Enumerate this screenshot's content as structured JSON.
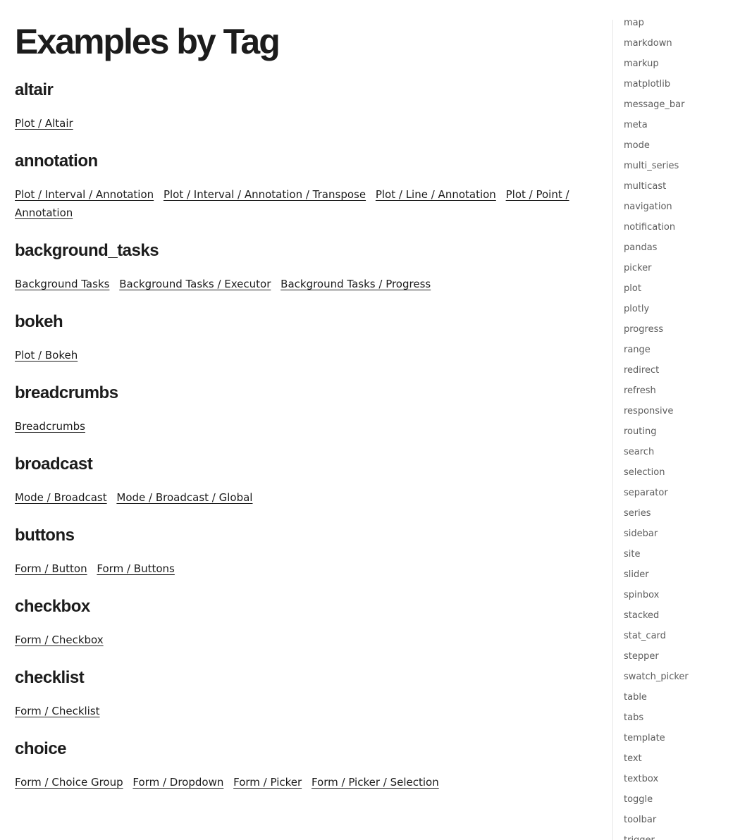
{
  "page": {
    "title": "Examples by Tag"
  },
  "sections": [
    {
      "tag": "altair",
      "links": [
        "Plot / Altair"
      ]
    },
    {
      "tag": "annotation",
      "links": [
        "Plot / Interval / Annotation",
        "Plot / Interval / Annotation / Transpose",
        "Plot / Line / Annotation",
        "Plot / Point / Annotation"
      ]
    },
    {
      "tag": "background_tasks",
      "links": [
        "Background Tasks",
        "Background Tasks / Executor",
        "Background Tasks / Progress"
      ]
    },
    {
      "tag": "bokeh",
      "links": [
        "Plot / Bokeh"
      ]
    },
    {
      "tag": "breadcrumbs",
      "links": [
        "Breadcrumbs"
      ]
    },
    {
      "tag": "broadcast",
      "links": [
        "Mode / Broadcast",
        "Mode / Broadcast / Global"
      ]
    },
    {
      "tag": "buttons",
      "links": [
        "Form / Button",
        "Form / Buttons"
      ]
    },
    {
      "tag": "checkbox",
      "links": [
        "Form / Checkbox"
      ]
    },
    {
      "tag": "checklist",
      "links": [
        "Form / Checklist"
      ]
    },
    {
      "tag": "choice",
      "links": [
        "Form / Choice Group",
        "Form / Dropdown",
        "Form / Picker",
        "Form / Picker / Selection"
      ]
    }
  ],
  "sidebar": {
    "tags": [
      "map",
      "markdown",
      "markup",
      "matplotlib",
      "message_bar",
      "meta",
      "mode",
      "multi_series",
      "multicast",
      "navigation",
      "notification",
      "pandas",
      "picker",
      "plot",
      "plotly",
      "progress",
      "range",
      "redirect",
      "refresh",
      "responsive",
      "routing",
      "search",
      "selection",
      "separator",
      "series",
      "sidebar",
      "site",
      "slider",
      "spinbox",
      "stacked",
      "stat_card",
      "stepper",
      "swatch_picker",
      "table",
      "tabs",
      "template",
      "text",
      "textbox",
      "toggle",
      "toolbar",
      "trigger"
    ]
  }
}
